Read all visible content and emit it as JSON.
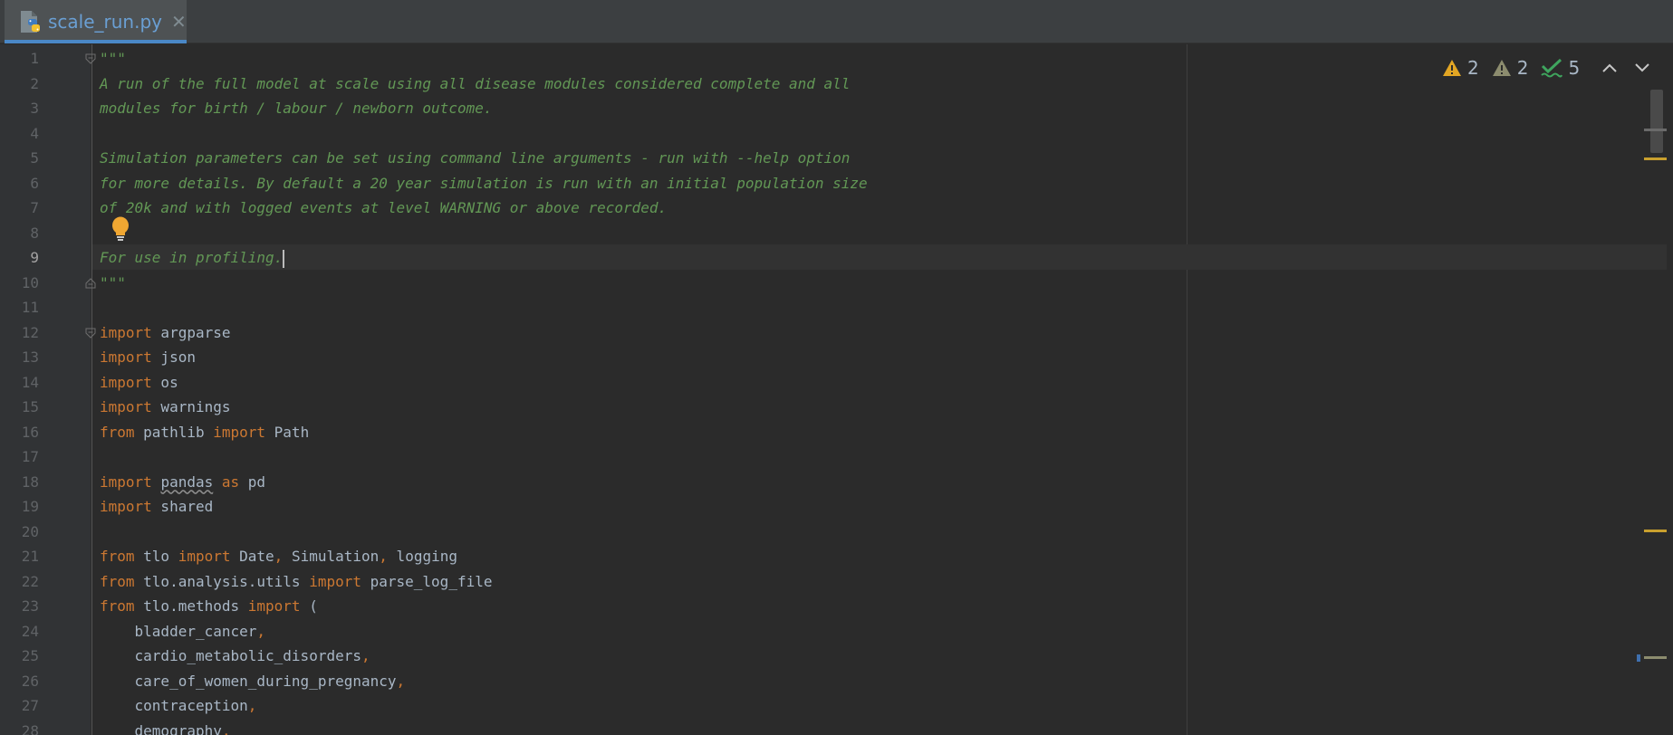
{
  "tab": {
    "filename": "scale_run.py",
    "close_glyph": "✕",
    "icon": "python-file-icon"
  },
  "inspections": {
    "warnings_count": "2",
    "weak_warnings_count": "2",
    "typos_count": "5",
    "prev_glyph": "⌃",
    "next_glyph": "⌄"
  },
  "colors": {
    "background": "#2b2b2b",
    "docstring": "#629755",
    "keyword": "#cc7832",
    "identifier": "#a9b7c6",
    "line_number": "#606366",
    "tab_accent": "#4a88c7",
    "warning": "#e2a624"
  },
  "editor": {
    "active_line": 9,
    "lines": [
      {
        "n": "1",
        "tokens": [
          {
            "t": "\"\"\"",
            "c": "doc"
          }
        ]
      },
      {
        "n": "2",
        "tokens": [
          {
            "t": "A run of the full model at scale using all disease modules considered complete and all",
            "c": "doc"
          }
        ]
      },
      {
        "n": "3",
        "tokens": [
          {
            "t": "modules for birth / labour / newborn outcome.",
            "c": "doc"
          }
        ]
      },
      {
        "n": "4",
        "tokens": []
      },
      {
        "n": "5",
        "tokens": [
          {
            "t": "Simulation parameters can be set using command line arguments - run with --help option",
            "c": "doc"
          }
        ]
      },
      {
        "n": "6",
        "tokens": [
          {
            "t": "for more details. By default a 20 year simulation is run with an initial population size",
            "c": "doc"
          }
        ]
      },
      {
        "n": "7",
        "tokens": [
          {
            "t": "of 20k and with logged events at level WARNING or above recorded.",
            "c": "doc"
          }
        ]
      },
      {
        "n": "8",
        "tokens": []
      },
      {
        "n": "9",
        "tokens": [
          {
            "t": "For use in profiling.",
            "c": "doc"
          }
        ],
        "caret": true
      },
      {
        "n": "10",
        "tokens": [
          {
            "t": "\"\"\"",
            "c": "doc"
          }
        ]
      },
      {
        "n": "11",
        "tokens": []
      },
      {
        "n": "12",
        "tokens": [
          {
            "t": "import",
            "c": "kw"
          },
          {
            "t": " argparse",
            "c": "id"
          }
        ]
      },
      {
        "n": "13",
        "tokens": [
          {
            "t": "import",
            "c": "kw"
          },
          {
            "t": " json",
            "c": "id"
          }
        ]
      },
      {
        "n": "14",
        "tokens": [
          {
            "t": "import",
            "c": "kw"
          },
          {
            "t": " os",
            "c": "id"
          }
        ]
      },
      {
        "n": "15",
        "tokens": [
          {
            "t": "import",
            "c": "kw"
          },
          {
            "t": " warnings",
            "c": "id"
          }
        ]
      },
      {
        "n": "16",
        "tokens": [
          {
            "t": "from",
            "c": "kw"
          },
          {
            "t": " pathlib ",
            "c": "id"
          },
          {
            "t": "import",
            "c": "kw"
          },
          {
            "t": " Path",
            "c": "id"
          }
        ]
      },
      {
        "n": "17",
        "tokens": []
      },
      {
        "n": "18",
        "tokens": [
          {
            "t": "import",
            "c": "kw"
          },
          {
            "t": " ",
            "c": "id"
          },
          {
            "t": "pandas",
            "c": "wavy"
          },
          {
            "t": " ",
            "c": "id"
          },
          {
            "t": "as",
            "c": "kw"
          },
          {
            "t": " pd",
            "c": "id"
          }
        ]
      },
      {
        "n": "19",
        "tokens": [
          {
            "t": "import",
            "c": "kw"
          },
          {
            "t": " shared",
            "c": "id"
          }
        ]
      },
      {
        "n": "20",
        "tokens": []
      },
      {
        "n": "21",
        "tokens": [
          {
            "t": "from",
            "c": "kw"
          },
          {
            "t": " tlo ",
            "c": "id"
          },
          {
            "t": "import",
            "c": "kw"
          },
          {
            "t": " Date",
            "c": "id"
          },
          {
            "t": ",",
            "c": "punc"
          },
          {
            "t": " Simulation",
            "c": "id"
          },
          {
            "t": ",",
            "c": "punc"
          },
          {
            "t": " logging",
            "c": "id"
          }
        ]
      },
      {
        "n": "22",
        "tokens": [
          {
            "t": "from",
            "c": "kw"
          },
          {
            "t": " tlo.analysis.utils ",
            "c": "id"
          },
          {
            "t": "import",
            "c": "kw"
          },
          {
            "t": " parse_log_file",
            "c": "id"
          }
        ]
      },
      {
        "n": "23",
        "tokens": [
          {
            "t": "from",
            "c": "kw"
          },
          {
            "t": " tlo.methods ",
            "c": "id"
          },
          {
            "t": "import",
            "c": "kw"
          },
          {
            "t": " (",
            "c": "id"
          }
        ]
      },
      {
        "n": "24",
        "tokens": [
          {
            "t": "    bladder_cancer",
            "c": "id"
          },
          {
            "t": ",",
            "c": "punc"
          }
        ]
      },
      {
        "n": "25",
        "tokens": [
          {
            "t": "    cardio_metabolic_disorders",
            "c": "id"
          },
          {
            "t": ",",
            "c": "punc"
          }
        ]
      },
      {
        "n": "26",
        "tokens": [
          {
            "t": "    care_of_women_during_pregnancy",
            "c": "id"
          },
          {
            "t": ",",
            "c": "punc"
          }
        ]
      },
      {
        "n": "27",
        "tokens": [
          {
            "t": "    contraception",
            "c": "id"
          },
          {
            "t": ",",
            "c": "punc"
          }
        ]
      },
      {
        "n": "28",
        "tokens": [
          {
            "t": "    demography",
            "c": "id"
          },
          {
            "t": ",",
            "c": "punc"
          }
        ]
      }
    ]
  }
}
